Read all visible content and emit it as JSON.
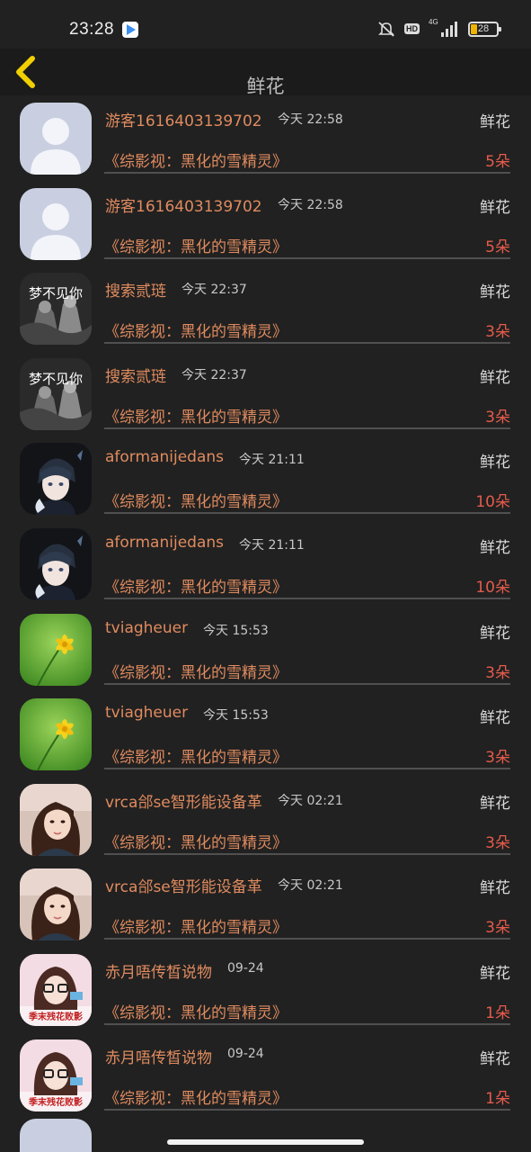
{
  "status_bar": {
    "time": "23:28",
    "hd": "HD",
    "network": "4G",
    "battery": "28"
  },
  "header": {
    "title": "鲜花"
  },
  "colors": {
    "background": "#212121",
    "username": "#e08b5f",
    "count": "#e55b4b",
    "back_arrow": "#f0d000"
  },
  "records": [
    {
      "avatar": "default-user-avatar",
      "user": "游客1616403139702",
      "time": "今天 22:58",
      "gift": "鲜花",
      "book": "《综影视：黑化的雪精灵》",
      "count": "5朵"
    },
    {
      "avatar": "default-user-avatar",
      "user": "游客1616403139702",
      "time": "今天 22:58",
      "gift": "鲜花",
      "book": "《综影视：黑化的雪精灵》",
      "count": "5朵"
    },
    {
      "avatar": "bw-couple-avatar",
      "avatar_text": "梦不见你",
      "user": "搜索贰琏",
      "time": "今天 22:37",
      "gift": "鲜花",
      "book": "《综影视：黑化的雪精灵》",
      "count": "3朵"
    },
    {
      "avatar": "bw-couple-avatar",
      "avatar_text": "梦不见你",
      "user": "搜索贰琏",
      "time": "今天 22:37",
      "gift": "鲜花",
      "book": "《综影视：黑化的雪精灵》",
      "count": "3朵"
    },
    {
      "avatar": "anime-boy-avatar",
      "user": "aformanijedans",
      "time": "今天 21:11",
      "gift": "鲜花",
      "book": "《综影视：黑化的雪精灵》",
      "count": "10朵"
    },
    {
      "avatar": "anime-boy-avatar",
      "user": "aformanijedans",
      "time": "今天 21:11",
      "gift": "鲜花",
      "book": "《综影视：黑化的雪精灵》",
      "count": "10朵"
    },
    {
      "avatar": "yellow-flower-avatar",
      "user": "tviagheuer",
      "time": "今天 15:53",
      "gift": "鲜花",
      "book": "《综影视：黑化的雪精灵》",
      "count": "3朵"
    },
    {
      "avatar": "yellow-flower-avatar",
      "user": "tviagheuer",
      "time": "今天 15:53",
      "gift": "鲜花",
      "book": "《综影视：黑化的雪精灵》",
      "count": "3朵"
    },
    {
      "avatar": "girl-photo-avatar",
      "user": "vrca郃se智形能设备革",
      "time": "今天 02:21",
      "gift": "鲜花",
      "book": "《综影视：黑化的雪精灵》",
      "count": "3朵"
    },
    {
      "avatar": "girl-photo-avatar",
      "user": "vrca郃se智形能设备革",
      "time": "今天 02:21",
      "gift": "鲜花",
      "book": "《综影视：黑化的雪精灵》",
      "count": "3朵"
    },
    {
      "avatar": "glasses-girl-avatar",
      "avatar_text": "季末残花败影",
      "user": "赤月唔传皙说物",
      "time": "09-24",
      "gift": "鲜花",
      "book": "《综影视：黑化的雪精灵》",
      "count": "1朵"
    },
    {
      "avatar": "glasses-girl-avatar",
      "avatar_text": "季末残花败影",
      "user": "赤月唔传皙说物",
      "time": "09-24",
      "gift": "鲜花",
      "book": "《综影视：黑化的雪精灵》",
      "count": "1朵"
    }
  ]
}
